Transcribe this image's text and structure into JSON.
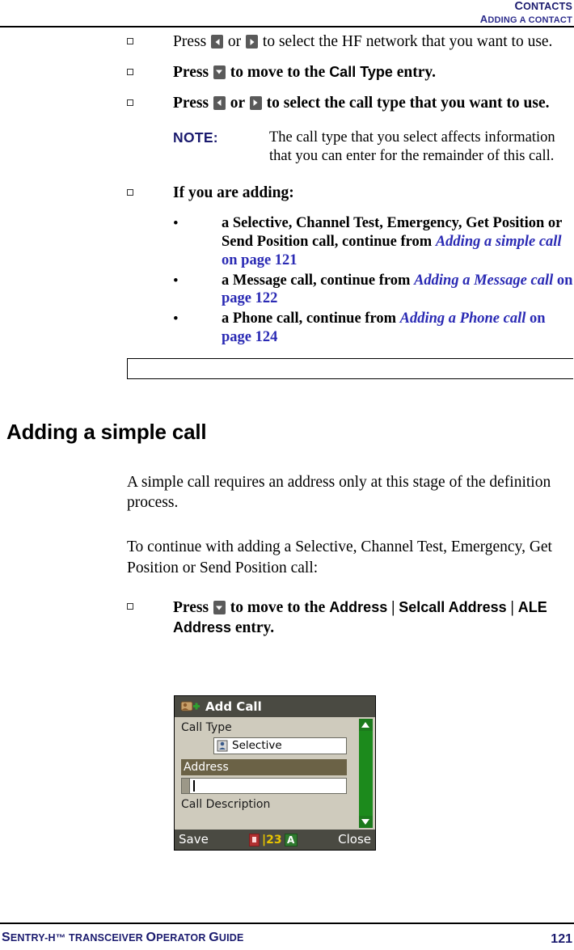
{
  "header": {
    "line1_first": "C",
    "line1_rest": "ONTACTS",
    "line2_first": "A",
    "line2_rest": "DDING A CONTACT"
  },
  "steps": [
    {
      "id": "step-hf-network",
      "pre": "Press ",
      "mid": " or ",
      "post": " to select the HF network that you want to use.",
      "icons": [
        "left-arrow-key-icon",
        "right-arrow-key-icon"
      ]
    },
    {
      "id": "step-call-type",
      "pre": "Press ",
      "mid": " to move to the ",
      "bold": "Call Type",
      "post": " entry.",
      "icons": [
        "down-arrow-key-icon"
      ]
    },
    {
      "id": "step-select-call-type",
      "pre": "Press ",
      "mid": " or ",
      "post": " to select the call type that you want to use.",
      "icons": [
        "left-arrow-key-icon",
        "right-arrow-key-icon"
      ]
    }
  ],
  "note": {
    "label": "NOTE:",
    "body": "The call type that you select affects information that you can enter for the remainder of this call."
  },
  "if_adding": {
    "lead": "If you are adding:",
    "items": [
      {
        "text_before": "a Selective, Channel Test, Emergency, Get Position or Send Position call, continue from ",
        "xref_italic": "Adding a simple call",
        "xref_tail": " on page 121"
      },
      {
        "text_before": "a Message call, continue from ",
        "xref_italic": "Adding a Message call",
        "xref_tail": " on page 122"
      },
      {
        "text_before": "a Phone call, continue from ",
        "xref_italic": "Adding a Phone call",
        "xref_tail": " on page 124"
      }
    ]
  },
  "section": {
    "title": "Adding a simple call",
    "para1": "A simple call requires an address only at this stage of the definition process.",
    "para2": "To continue with adding a Selective, Channel Test, Emergency, Get Position or Send Position call:",
    "step": {
      "pre": "Press ",
      "mid": " to move to the ",
      "bold1": "Address",
      "sep1": " | ",
      "bold2": "Selcall Address",
      "sep2": " | ",
      "bold3": "ALE Address",
      "post": " entry.",
      "icon": "down-arrow-key-icon"
    }
  },
  "device": {
    "title": "Add Call",
    "title_icon": "add-call-icon",
    "label_call_type": "Call Type",
    "call_type_value": "Selective",
    "call_type_icon": "person-icon",
    "address_bar_label": "Address",
    "label_call_description": "Call Description",
    "footer_save": "Save",
    "footer_close": "Close",
    "status_lock_icon": "lock-icon",
    "status_123": "|23",
    "status_a": "A",
    "scroll_up_icon": "scroll-up-arrow-icon",
    "scroll_down_icon": "scroll-down-arrow-icon"
  },
  "footer": {
    "left_first": "S",
    "left_rest": "ENTRY-H™ T",
    "left_rest2": "RANSCEIVER ",
    "left_o": "O",
    "left_rest3": "PERATOR ",
    "left_g": "G",
    "left_rest4": "UIDE",
    "page_number": "121"
  }
}
